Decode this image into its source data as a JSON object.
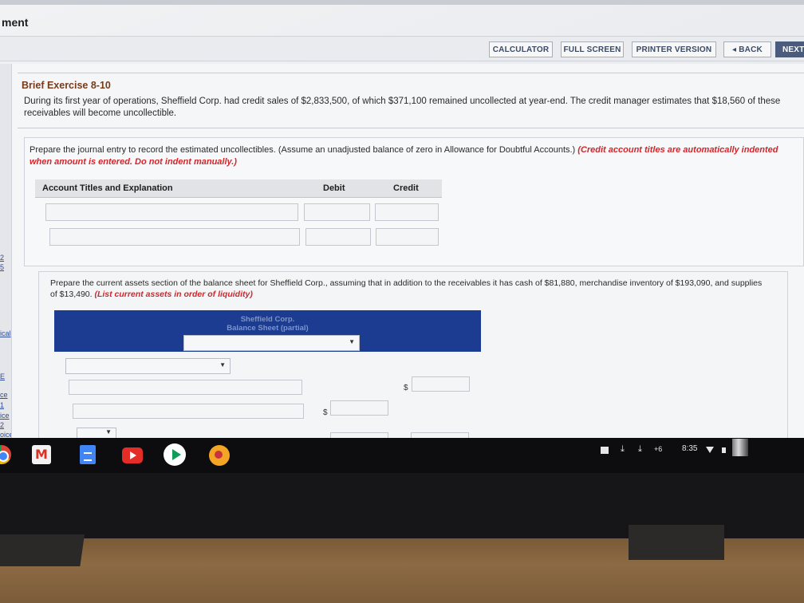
{
  "page": {
    "title_fragment": "ment"
  },
  "nav": {
    "calculator": "CALCULATOR",
    "full_screen": "FULL SCREEN",
    "printer_version": "PRINTER VERSION",
    "back": "◂ BACK",
    "next": "NEXT"
  },
  "sidebar": {
    "links": [
      "2",
      "5",
      "ical",
      "E",
      "ce",
      "1",
      "ice",
      "2",
      "oice"
    ]
  },
  "exercise": {
    "title": "Brief Exercise 8-10",
    "intro": "During its first year of operations, Sheffield Corp. had credit sales of $2,833,500, of which $371,100 remained uncollected at year-end. The credit manager estimates that $18,560 of these receivables will become uncollectible."
  },
  "part1": {
    "instruction": "Prepare the journal entry to record the estimated uncollectibles. (Assume an unadjusted balance of zero in Allowance for Doubtful Accounts.)",
    "red_note": "(Credit account titles are automatically indented when amount is entered. Do not indent manually.)",
    "table": {
      "columns": [
        "Account Titles and Explanation",
        "Debit",
        "Credit"
      ]
    }
  },
  "part2": {
    "instruction": "Prepare the current assets section of the balance sheet for Sheffield Corp., assuming that in addition to the receivables it has cash of $81,880, merchandise inventory of $193,090, and supplies of $13,490.",
    "red_note": "(List current assets in order of liquidity)",
    "balance_sheet": {
      "company": "Sheffield Corp.",
      "subtitle": "Balance Sheet (partial)"
    },
    "dollar_sign": "$"
  },
  "taskbar": {
    "badge": "+6",
    "time": "8:35",
    "download_glyph": "⤓"
  }
}
